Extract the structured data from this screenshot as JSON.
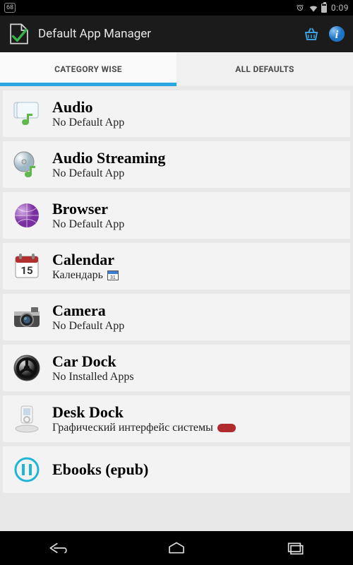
{
  "status": {
    "badge": "68",
    "time": "0:09"
  },
  "actionbar": {
    "title": "Default App Manager"
  },
  "tabs": {
    "category": "CATEGORY WISE",
    "all": "ALL DEFAULTS"
  },
  "rows": [
    {
      "title": "Audio",
      "sub": "No Default App",
      "icon": "audio"
    },
    {
      "title": "Audio Streaming",
      "sub": "No Default App",
      "icon": "audio-stream"
    },
    {
      "title": "Browser",
      "sub": "No Default App",
      "icon": "browser"
    },
    {
      "title": "Calendar",
      "sub": "Календарь",
      "icon": "calendar",
      "trail": "cal"
    },
    {
      "title": "Camera",
      "sub": "No Default App",
      "icon": "camera"
    },
    {
      "title": "Car Dock",
      "sub": "No Installed Apps",
      "icon": "cardock"
    },
    {
      "title": "Desk Dock",
      "sub": "Графический интерфейс системы",
      "icon": "deskdock",
      "trail": "pill"
    },
    {
      "title": "Ebooks (epub)",
      "sub": "",
      "icon": "ebooks"
    }
  ],
  "colors": {
    "accent": "#29a6e0"
  }
}
